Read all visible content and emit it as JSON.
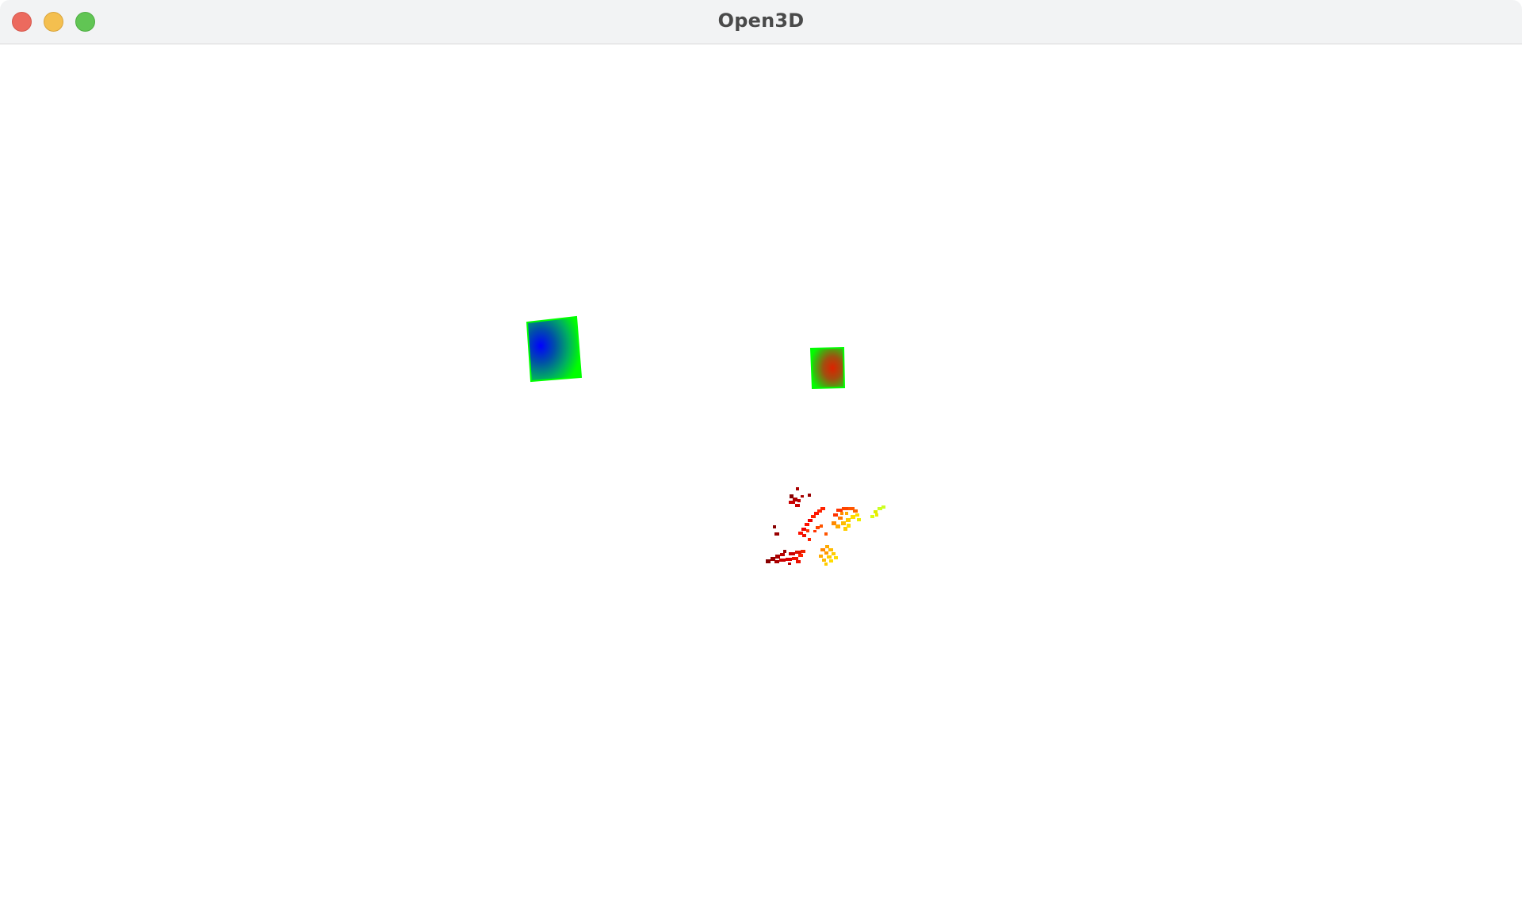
{
  "window": {
    "title": "Open3D",
    "controls": {
      "close": "close-window-icon",
      "minimize": "minimize-window-icon",
      "maximize": "maximize-window-icon"
    }
  },
  "scene": {
    "background": "#ffffff",
    "camera_frustum_1": {
      "edge_color": "#00ff00",
      "center_color": "#0000ff"
    },
    "camera_frustum_2": {
      "edge_color": "#00ff00",
      "center_color": "#dd2200"
    },
    "point_cloud": {
      "palette": [
        "#880000",
        "#cc0000",
        "#ff2200",
        "#ff6600",
        "#ffaa00",
        "#ffee00",
        "#ccff22"
      ]
    }
  }
}
